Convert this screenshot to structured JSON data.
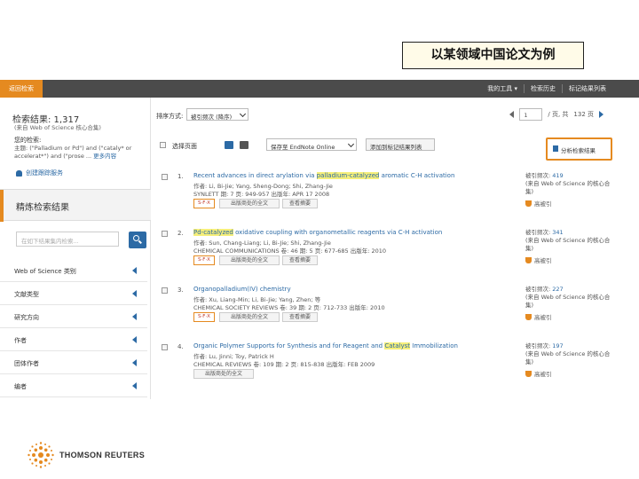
{
  "caption": "以某领域中国论文为例",
  "topbar": {
    "back": "返回检索",
    "menu": [
      "我的工具 ▾",
      "检索历史",
      "标记结果列表"
    ]
  },
  "sidebar": {
    "title": "检索结果: 1,317",
    "subtitle": "(来自 Web of Science 核心合集)",
    "query_title": "您的检索:",
    "query_text": "主题: (\"Palladium or Pd\") and (\"cataly* or accelerat*\") and (\"prose ...",
    "query_more": "更多内容",
    "alert": "创建跟踪服务",
    "refine": "精炼检索结果",
    "search_placeholder": "在如下结果集内检索...",
    "facets": [
      "Web of Science 类别",
      "文献类型",
      "研究方向",
      "作者",
      "团体作者",
      "编者"
    ]
  },
  "main": {
    "sort_label": "排序方式:",
    "sort_value": "被引频次 (降序)",
    "pager": {
      "page": "1",
      "of": "/ 页, 共",
      "total": "132 页"
    },
    "select_page": "选择页面",
    "save_select": "保存至 EndNote Online",
    "add_list": "添加到标记结果列表",
    "analyze": "分析检索结果",
    "records": [
      {
        "num": "1.",
        "title_pre": "Recent advances in direct arylation via ",
        "title_hl": "palladium-catalyzed",
        "title_post": " aromatic C-H activation",
        "authors": "作者: Li, Bi-Jie; Yang, Sheng-Dong; Shi, Zhang-Jie",
        "source": "SYNLETT  期: 7  页: 949-957  出版年: APR 17 2008",
        "cite_label": "被引频次: ",
        "cite_value": "419",
        "cite_src": "(来自 Web of Science 的核心合集)",
        "hot": "高被引"
      },
      {
        "num": "2.",
        "title_pre": "",
        "title_hl": "Pd-catalyzed",
        "title_post": " oxidative coupling with organometallic reagents via C-H activation",
        "authors": "作者: Sun, Chang-Liang; Li, Bi-Jie; Shi, Zhang-Jie",
        "source": "CHEMICAL COMMUNICATIONS  卷: 46  期: 5  页: 677-685  出版年: 2010",
        "cite_label": "被引频次: ",
        "cite_value": "341",
        "cite_src": "(来自 Web of Science 的核心合集)",
        "hot": "高被引"
      },
      {
        "num": "3.",
        "title_pre": "Organopalladium(IV) chemistry",
        "title_hl": "",
        "title_post": "",
        "authors": "作者: Xu, Liang-Min; Li, Bi-Jie; Yang, Zhen; 等",
        "source": "CHEMICAL SOCIETY REVIEWS  卷: 39  期: 2  页: 712-733  出版年: 2010",
        "cite_label": "被引频次: ",
        "cite_value": "227",
        "cite_src": "(来自 Web of Science 的核心合集)",
        "hot": "高被引"
      },
      {
        "num": "4.",
        "title_pre": "Organic Polymer Supports for Synthesis and for Reagent and ",
        "title_hl": "Catalyst",
        "title_post": " Immobilization",
        "authors": "作者: Lu, Jinni; Toy, Patrick H",
        "source": "CHEMICAL REVIEWS  卷: 109  期: 2  页: 815-838  出版年: FEB 2009",
        "cite_label": "被引频次: ",
        "cite_value": "197",
        "cite_src": "(来自 Web of Science 的核心合集)",
        "hot": "高被引"
      }
    ],
    "sfx": "S·F·X",
    "full_text": "出版商处的全文",
    "abstract": "查看摘要"
  },
  "footer": {
    "brand": "THOMSON REUTERS"
  }
}
